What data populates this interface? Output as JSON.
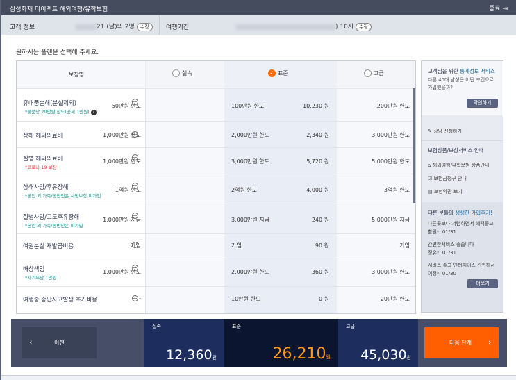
{
  "header": {
    "title": "삼성화재 다이렉트 해외여행/유학보험",
    "close_label": "종료"
  },
  "info": {
    "customer_label": "고객 정보",
    "customer_value": "21 (남)외 2명",
    "period_label": "여행기간",
    "period_value": ") 10시",
    "edit_label": "수정"
  },
  "prompt": "원하시는 플랜을 선택해 주세요.",
  "table": {
    "header": "보장명",
    "plans": [
      {
        "label": "실속",
        "selected": false
      },
      {
        "label": "표준",
        "selected": true
      },
      {
        "label": "고급",
        "selected": false
      }
    ],
    "rows": [
      {
        "name": "휴대품손해(분실제외)",
        "note": "*물품당 20만원 한도(공제 1만원)",
        "basic": "50만원 한도",
        "std": "100만원 한도",
        "std_price": "10,230 원",
        "premium": "200만원 한도"
      },
      {
        "name": "상해 해외의료비",
        "note": "",
        "basic": "1,000만원 한도",
        "std": "2,000만원 한도",
        "std_price": "2,340 원",
        "premium": "3,000만원 한도"
      },
      {
        "name": "질병 해외의료비",
        "note": "*코로나 19 보장",
        "basic": "1,000만원 한도",
        "std": "3,000만원 한도",
        "std_price": "5,720 원",
        "premium": "5,000만원 한도"
      },
      {
        "name": "상해사망/후유장해",
        "note": "*본인 외 가족/동반인은 사망보장 미가입",
        "basic": "1억원 한도",
        "std": "2억원 한도",
        "std_price": "4,000 원",
        "premium": "3억원 한도"
      },
      {
        "name": "질병사망/고도후유장해",
        "note": "*본인 외 가족/동반인은 미가입",
        "basic": "1,000만원 지급",
        "std": "3,000만원 지급",
        "std_price": "240 원",
        "premium": "5,000만원 지급"
      },
      {
        "name": "여권분실 재발급비용",
        "note": "",
        "basic": "가입",
        "std": "가입",
        "std_price": "90 원",
        "premium": "가입"
      },
      {
        "name": "배상책임",
        "note": "*자기부담 1만원",
        "basic": "1,000만원 한도",
        "std": "2,000만원 한도",
        "std_price": "360 원",
        "premium": "3,000만원 한도"
      },
      {
        "name": "여행중 중단사고발생 추가비용",
        "note": "",
        "basic": "-",
        "std": "10만원 한도",
        "std_price": "0 원",
        "premium": "20만원 한도"
      }
    ]
  },
  "sidebar": {
    "stats_title_a": "고객님을 위한 ",
    "stats_title_b": "통계정보 서비스",
    "stats_text": "다른 40대 남성은 어떤 조건으로 가입했을까?",
    "confirm_label": "확인하기",
    "consult_label": "상담 신청하기",
    "guide_title": "보험상품/보상서비스 안내",
    "guide_items": [
      "해외여행/유학보험 상품안내",
      "보험금청구 안내",
      "보험약관 보기"
    ],
    "reviews_title_a": "다른 분들의 ",
    "reviews_title_b": "생생한 가입후기!",
    "reviews": [
      {
        "text": "다른곳보다 저렴하면서 혜택좋고",
        "author": "함원*, 01/31"
      },
      {
        "text": "간편한서비스 좋습니다",
        "author": "정유*, 01/31"
      },
      {
        "text": "서비스 좋고 인터페이스 간편해서",
        "author": "이정*, 01/30"
      }
    ],
    "more_label": "더보기"
  },
  "footer": {
    "prev_label": "이전",
    "next_label": "다음 단계",
    "prices": [
      {
        "label": "실속",
        "value": "12,360",
        "unit": "원"
      },
      {
        "label": "표준",
        "value": "26,210",
        "unit": "원"
      },
      {
        "label": "고급",
        "value": "45,030",
        "unit": "원"
      }
    ]
  },
  "colors": {
    "accent": "#ff5f00",
    "header_bg": "#454c5e",
    "selected_col": "#e9edf6",
    "note_teal": "#1a8a8a",
    "note_red": "#e83a3a"
  }
}
